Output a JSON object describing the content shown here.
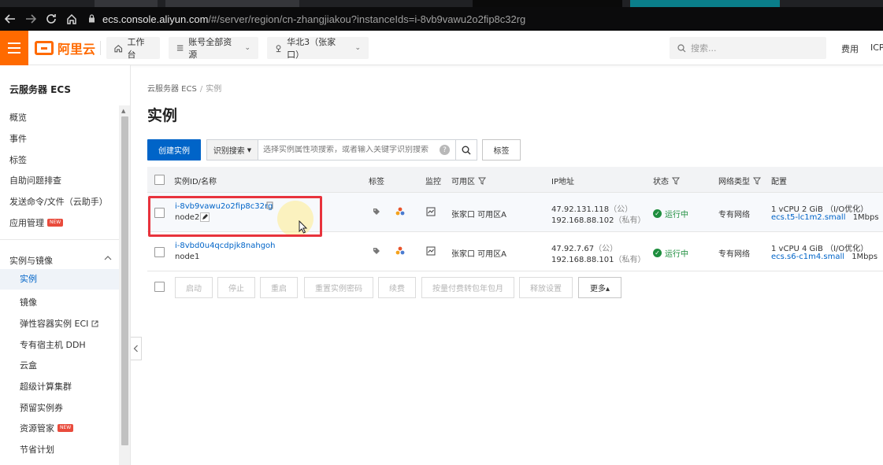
{
  "browser": {
    "url_host": "ecs.console.aliyun.com",
    "url_path": "/#/server/region/cn-zhangjiakou?instanceIds=i-8vb9vawu2o2fip8c32rg"
  },
  "topnav": {
    "logo_text": "阿里云",
    "workbench": "工作台",
    "resources": "账号全部资源",
    "region": "华北3（张家口）",
    "search_placeholder": "搜索...",
    "fee": "费用",
    "icp": "ICP"
  },
  "sidebar": {
    "title": "云服务器 ECS",
    "items": [
      "概览",
      "事件",
      "标签",
      "自助问题排查",
      "发送命令/文件（云助手）",
      "应用管理"
    ],
    "badge_new": "NEW",
    "group_label": "实例与镜像",
    "sub_items": [
      "实例",
      "镜像",
      "弹性容器实例 ECI",
      "专有宿主机 DDH",
      "云盒",
      "超级计算集群",
      "预留实例券",
      "资源管家",
      "节省计划"
    ]
  },
  "main": {
    "breadcrumb_root": "云服务器 ECS",
    "breadcrumb_sep": "/",
    "breadcrumb_current": "实例",
    "title": "实例",
    "create_button": "创建实例",
    "search_mode": "识别搜索",
    "search_placeholder": "选择实例属性项搜索，或者输入关键字识别搜索",
    "tag_button": "标签"
  },
  "table": {
    "headers": {
      "id": "实例ID/名称",
      "tag": "标签",
      "monitor": "监控",
      "zone": "可用区",
      "ip": "IP地址",
      "status": "状态",
      "network": "网络类型",
      "config": "配置"
    },
    "rows": [
      {
        "id": "i-8vb9vawu2o2fip8c32rg",
        "name": "node2",
        "zone": "张家口 可用区A",
        "ip_public": "47.92.131.118",
        "ip_public_tag": "（公）",
        "ip_private": "192.168.88.102",
        "ip_private_tag": "（私有）",
        "status": "运行中",
        "network": "专有网络",
        "config_line1": "1 vCPU 2 GiB （I/O优化）",
        "config_type": "ecs.t5-lc1m2.small",
        "bandwidth": "1Mbps"
      },
      {
        "id": "i-8vbd0u4qcdpjk8nahgoh",
        "name": "node1",
        "zone": "张家口 可用区A",
        "ip_public": "47.92.7.67",
        "ip_public_tag": "（公）",
        "ip_private": "192.168.88.101",
        "ip_private_tag": "（私有）",
        "status": "运行中",
        "network": "专有网络",
        "config_line1": "1 vCPU 4 GiB （I/O优化）",
        "config_type": "ecs.s6-c1m4.small",
        "bandwidth": "1Mbps"
      }
    ]
  },
  "actions": [
    "启动",
    "停止",
    "重启",
    "重置实例密码",
    "续费",
    "按量付费转包年包月",
    "释放设置",
    "更多▴"
  ],
  "colors": {
    "brand": "#ff6a00",
    "primary": "#0064c8",
    "running": "#1e8e3e",
    "highlight": "#e8333c"
  }
}
